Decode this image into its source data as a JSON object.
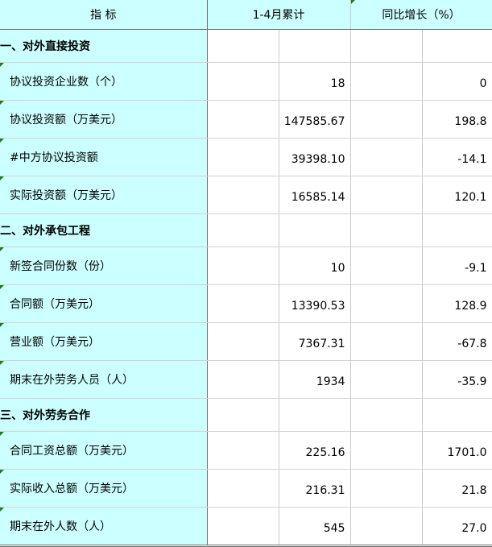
{
  "header": {
    "indicator_label": "指    标",
    "period_label": "1-4月累计",
    "growth_label": "同比增长（%）"
  },
  "rows": [
    {
      "label": "一、对外直接投资",
      "section": true
    },
    {
      "label": "协议投资企业数（个）",
      "value": "18",
      "growth": "0"
    },
    {
      "label": "协议投资额（万美元）",
      "value": "147585.67",
      "growth": "198.8"
    },
    {
      "label": "#中方协议投资额",
      "value": "39398.10",
      "growth": "-14.1"
    },
    {
      "label": "实际投资额（万美元）",
      "value": "16585.14",
      "growth": "120.1"
    },
    {
      "label": "二、对外承包工程",
      "section": true
    },
    {
      "label": "新签合同份数（份）",
      "value": "10",
      "growth": "-9.1"
    },
    {
      "label": "合同额（万美元）",
      "value": "13390.53",
      "growth": "128.9"
    },
    {
      "label": "营业额（万美元）",
      "value": "7367.31",
      "growth": "-67.8"
    },
    {
      "label": "期末在外劳务人员（人）",
      "value": "1934",
      "growth": "-35.9"
    },
    {
      "label": "三、对外劳务合作",
      "section": true
    },
    {
      "label": "合同工资总额（万美元）",
      "value": "225.16",
      "growth": "1701.0"
    },
    {
      "label": "实际收入总额（万美元）",
      "value": "216.31",
      "growth": "21.8"
    },
    {
      "label": "期末在外人数（人）",
      "value": "545",
      "growth": "27.0"
    }
  ],
  "colors": {
    "label_bg": "#ccffff",
    "grid": "#c9c9c9",
    "marker": "#1a7f1a"
  }
}
